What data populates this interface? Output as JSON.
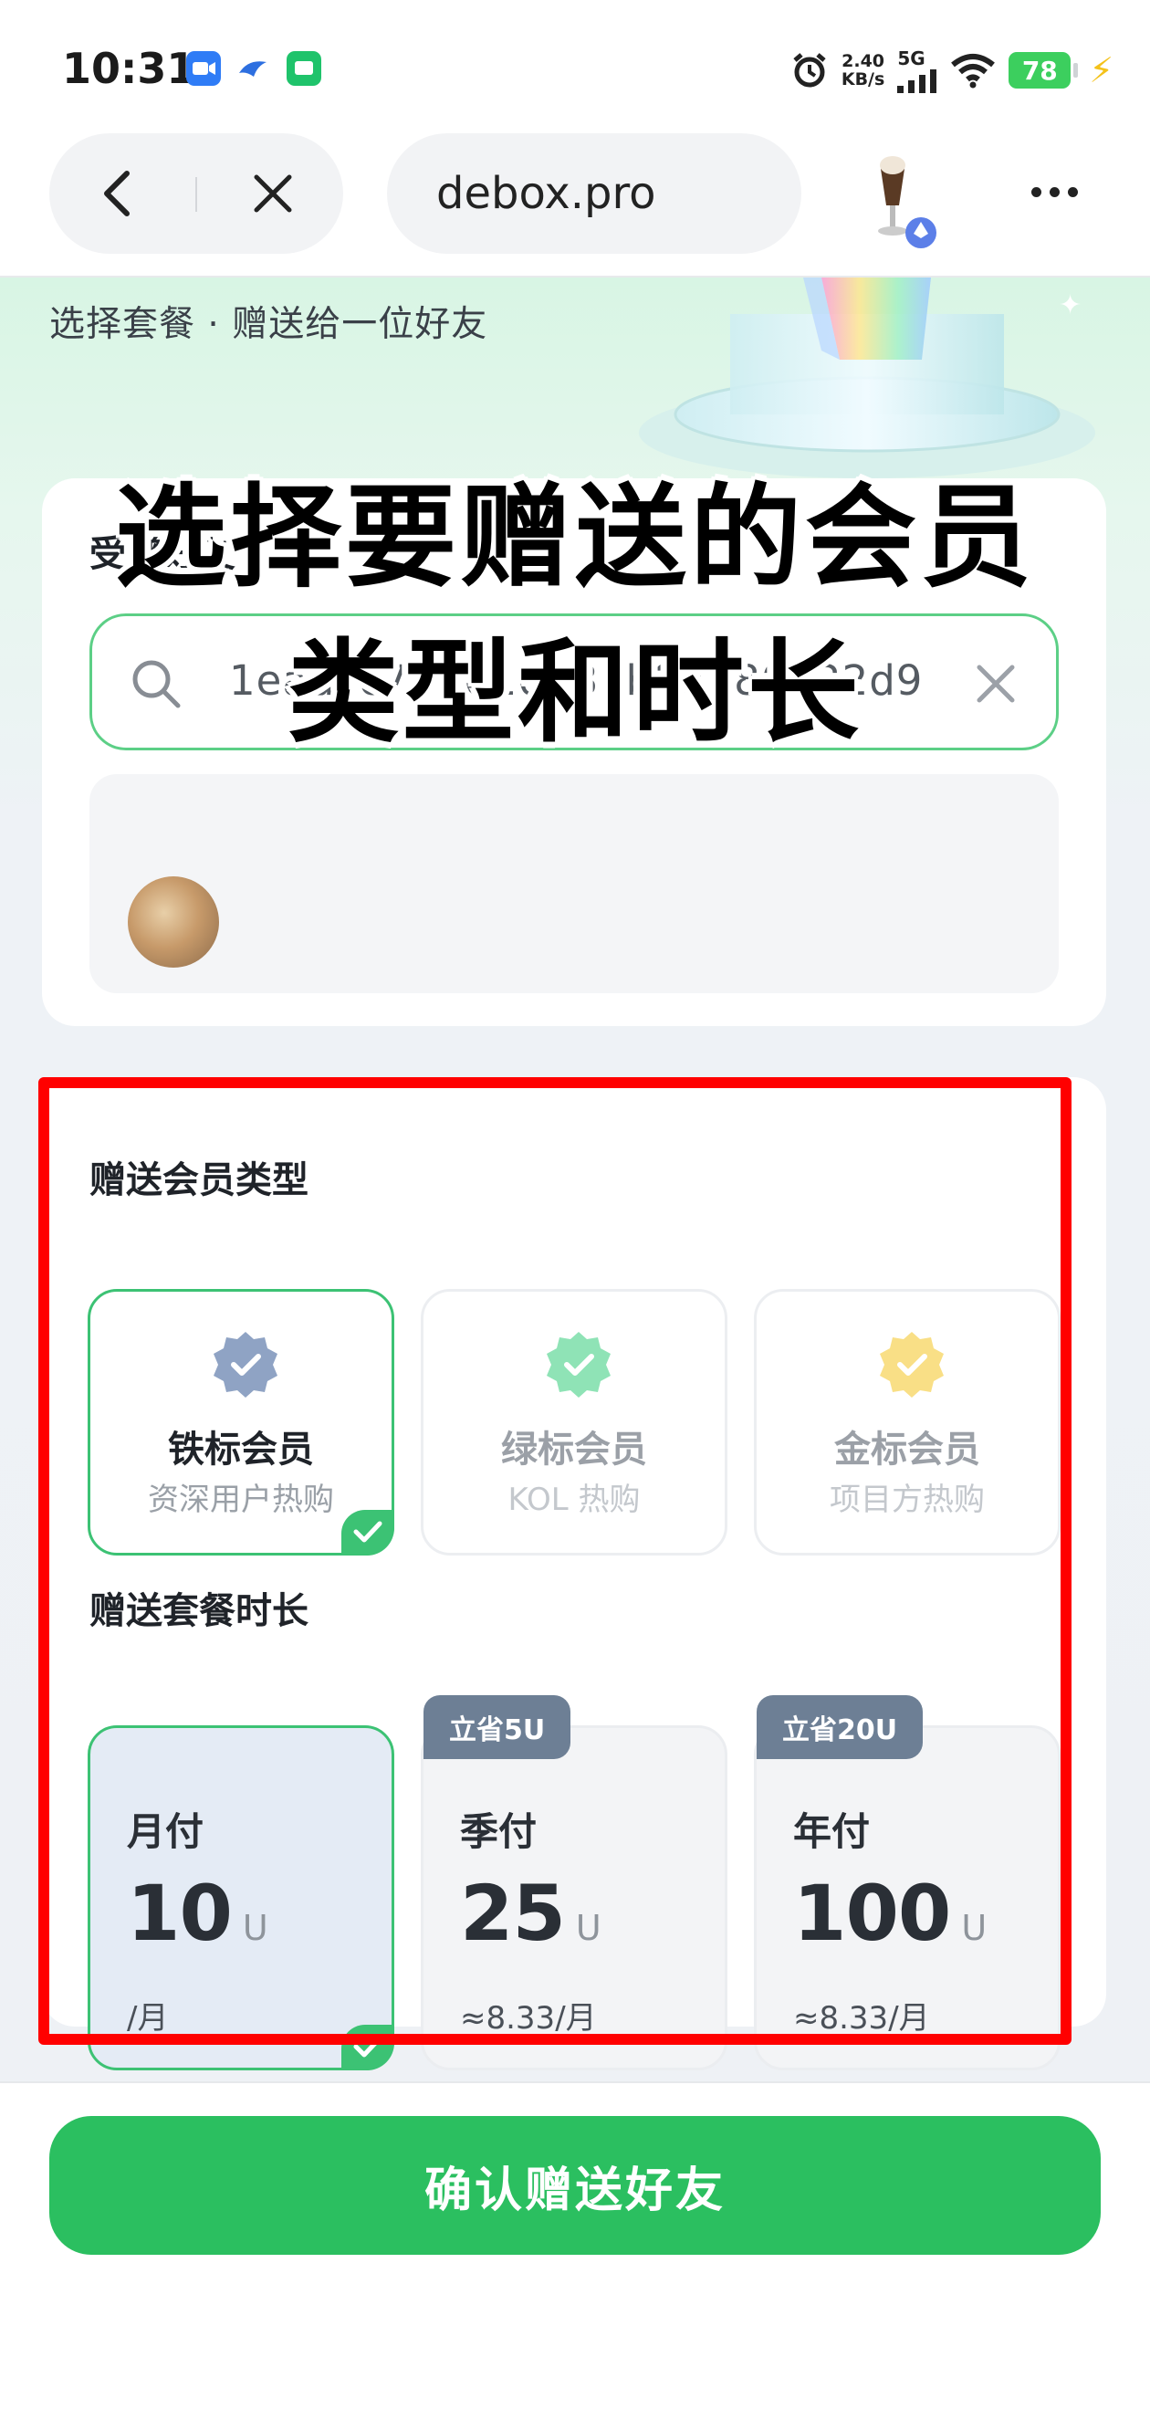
{
  "status_bar": {
    "time": "10:31",
    "net_speed_value": "2.40",
    "net_speed_unit": "KB/s",
    "network": "5G",
    "battery": "78"
  },
  "browser": {
    "url": "debox.pro"
  },
  "page": {
    "subtitle": "选择套餐 · 赠送给一位好友"
  },
  "friend_card": {
    "title": "受赠好友",
    "search_value": "1eadcc754610988b88180322d9"
  },
  "overlay_caption": {
    "line1": "选择要赠送的会员",
    "line2": "类型和时长"
  },
  "plan_card": {
    "type_title": "赠送会员类型",
    "types": [
      {
        "name": "铁标会员",
        "desc": "资深用户热购",
        "color": "#8fa3c4",
        "selected": true
      },
      {
        "name": "绿标会员",
        "desc": "KOL 热购",
        "color": "#6fdca2",
        "selected": false
      },
      {
        "name": "金标会员",
        "desc": "项目方热购",
        "color": "#f7d25d",
        "selected": false
      }
    ],
    "duration_title": "赠送套餐时长",
    "durations": [
      {
        "label": "月付",
        "price": "10",
        "unit": "U",
        "per": "/月",
        "tag": "",
        "selected": true
      },
      {
        "label": "季付",
        "price": "25",
        "unit": "U",
        "per": "≈8.33/月",
        "tag": "立省5U",
        "selected": false
      },
      {
        "label": "年付",
        "price": "100",
        "unit": "U",
        "per": "≈8.33/月",
        "tag": "立省20U",
        "selected": false
      }
    ]
  },
  "confirm_button": "确认赠送好友",
  "colors": {
    "accent_green": "#2bbf60",
    "highlight_red": "#ff0000",
    "tag_slate": "#6d7f95"
  }
}
